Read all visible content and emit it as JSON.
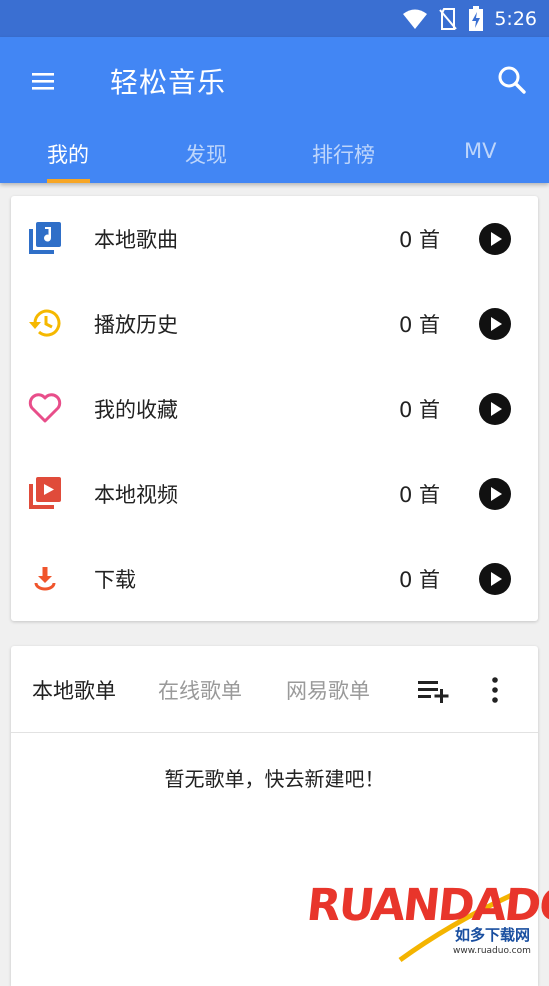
{
  "status_bar": {
    "time": "5:26"
  },
  "app_bar": {
    "title": "轻松音乐"
  },
  "tabs": [
    {
      "label": "我的"
    },
    {
      "label": "发现"
    },
    {
      "label": "排行榜"
    },
    {
      "label": "MV"
    }
  ],
  "library": [
    {
      "label": "本地歌曲",
      "count": "0 首",
      "icon": "music-library-icon",
      "color": "#2f6fc8"
    },
    {
      "label": "播放历史",
      "count": "0 首",
      "icon": "history-icon",
      "color": "#f5b800"
    },
    {
      "label": "我的收藏",
      "count": "0 首",
      "icon": "heart-icon",
      "color": "#e84e8a"
    },
    {
      "label": "本地视频",
      "count": "0 首",
      "icon": "video-library-icon",
      "color": "#e04b3a"
    },
    {
      "label": "下载",
      "count": "0 首",
      "icon": "download-icon",
      "color": "#f0552c"
    }
  ],
  "playlists": {
    "tabs": [
      "本地歌单",
      "在线歌单",
      "网易歌单"
    ],
    "empty_message": "暂无歌单，快去新建吧！"
  },
  "watermark": {
    "main": "RUANDADO",
    "sub": "如多下载网",
    "url": "www.ruaduo.com"
  },
  "colors": {
    "primary": "#4286f4",
    "status_bar": "#3a6fd2",
    "indicator": "#f7a625"
  }
}
